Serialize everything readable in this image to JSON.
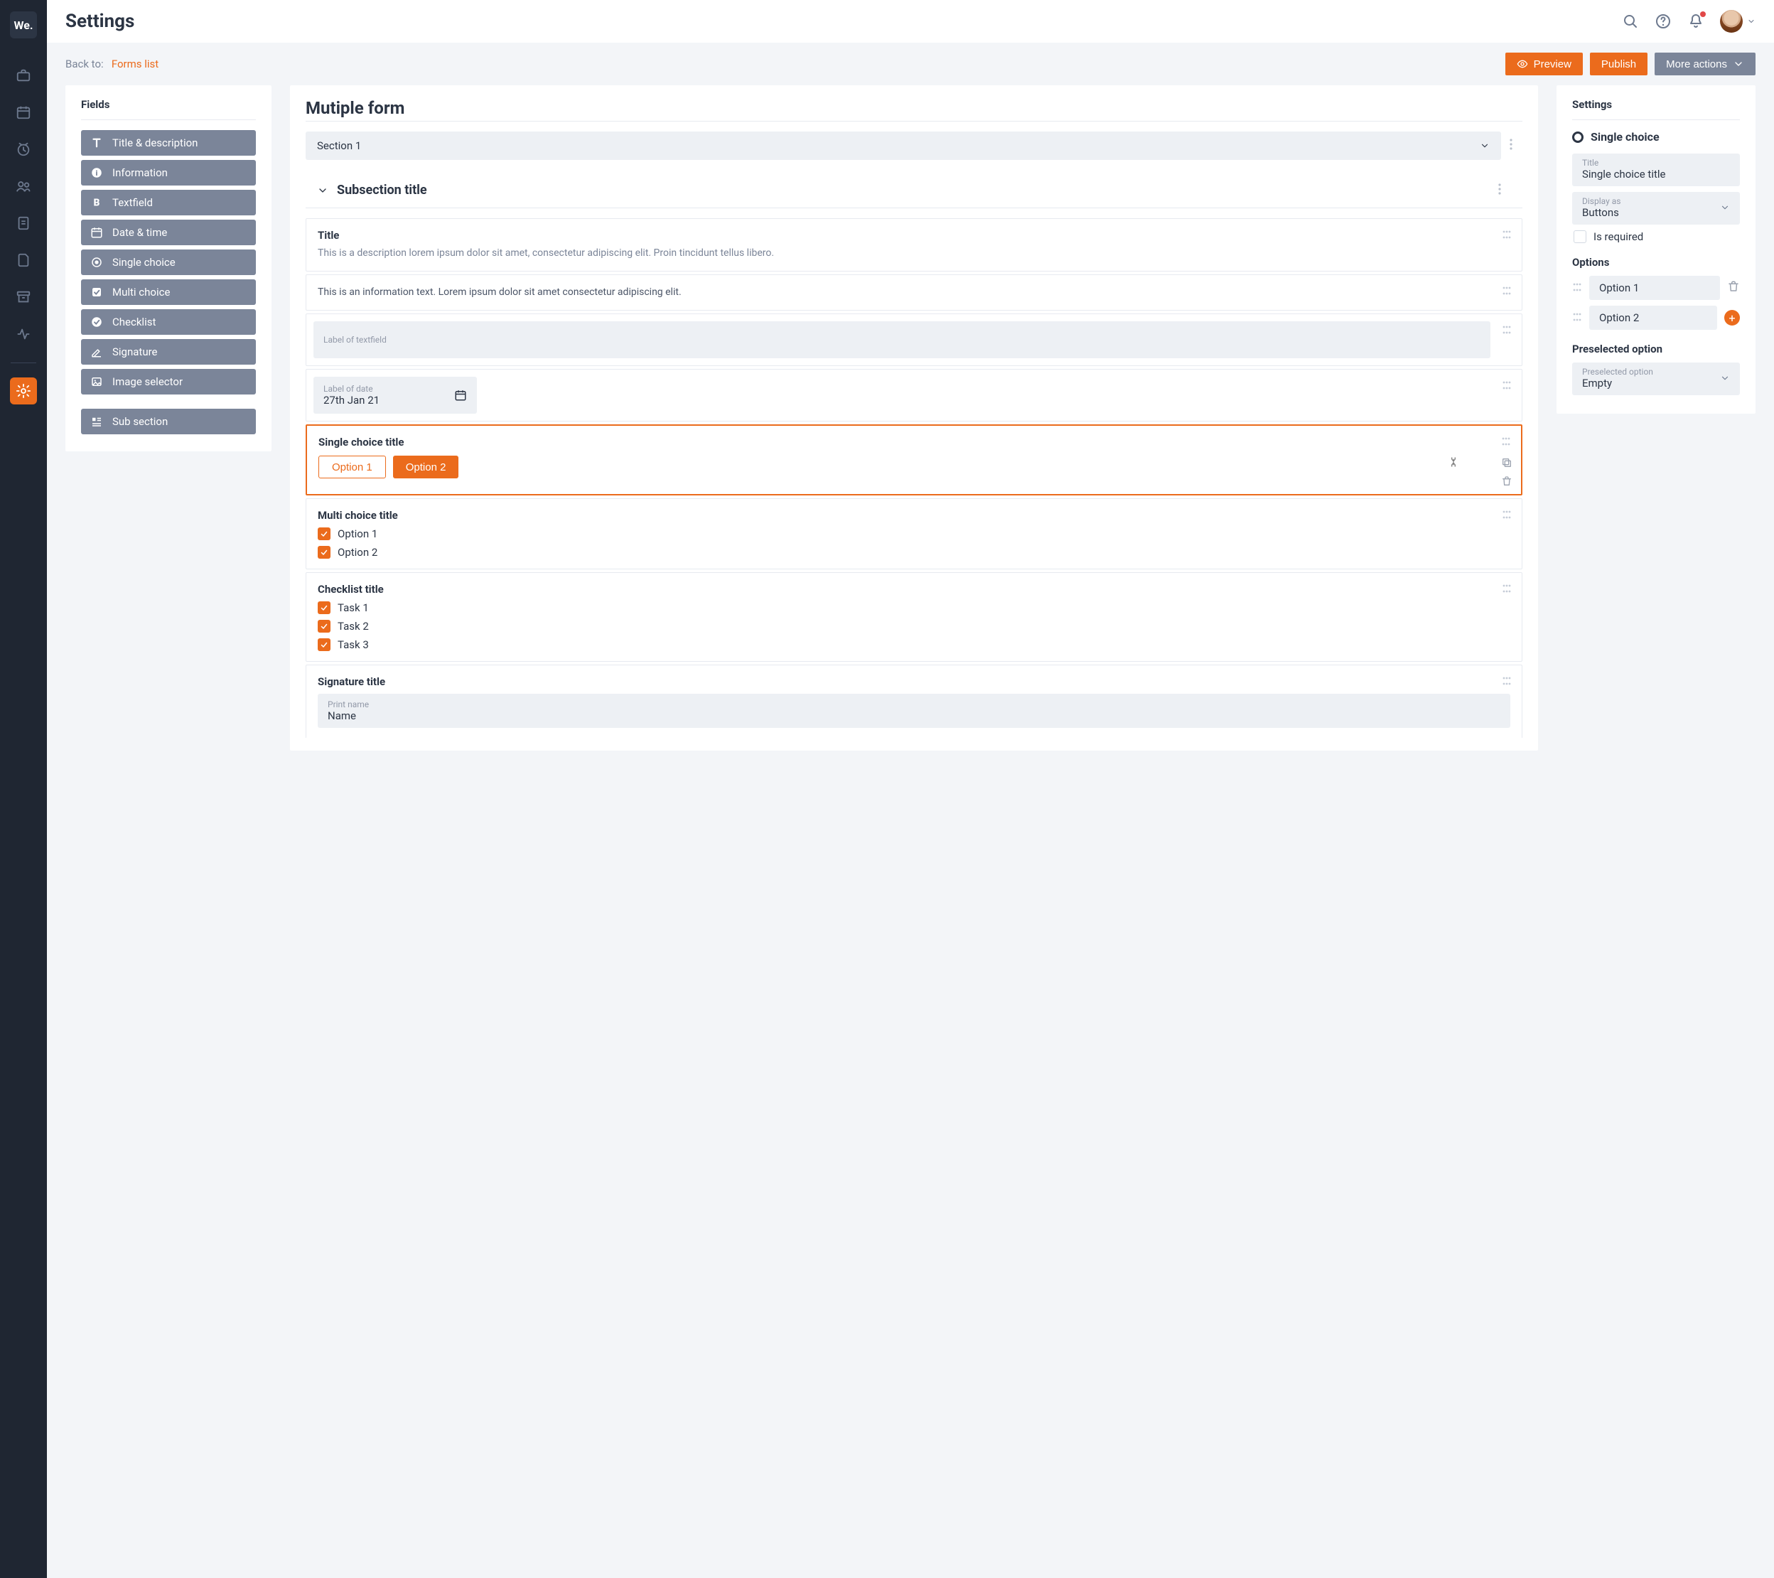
{
  "logo_text": "We.",
  "page_title": "Settings",
  "back": {
    "label": "Back to:",
    "link": "Forms list"
  },
  "actions": {
    "preview": "Preview",
    "publish": "Publish",
    "more": "More actions"
  },
  "fields_panel": {
    "title": "Fields",
    "items": [
      "Title & description",
      "Information",
      "Textfield",
      "Date & time",
      "Single choice",
      "Multi choice",
      "Checklist",
      "Signature",
      "Image selector"
    ],
    "subsection": "Sub section"
  },
  "builder": {
    "title": "Mutiple form",
    "section": "Section 1",
    "subsection": "Subsection title",
    "title_block": {
      "title": "Title",
      "desc": "This is a description lorem ipsum dolor sit amet, consectetur adipiscing elit. Proin tincidunt tellus libero."
    },
    "info_text": "This is an information text. Lorem ipsum dolor sit amet consectetur adipiscing elit.",
    "textfield_label": "Label of textfield",
    "date": {
      "label": "Label of date",
      "value": "27th Jan 21"
    },
    "single": {
      "title": "Single choice title",
      "opt1": "Option 1",
      "opt2": "Option 2"
    },
    "multi": {
      "title": "Multi choice title",
      "opt1": "Option 1",
      "opt2": "Option 2"
    },
    "checklist": {
      "title": "Checklist title",
      "t1": "Task 1",
      "t2": "Task 2",
      "t3": "Task 3"
    },
    "signature": {
      "title": "Signature title",
      "print_label": "Print name",
      "print_value": "Name"
    }
  },
  "settings_panel": {
    "title": "Settings",
    "component": "Single choice",
    "title_label": "Title",
    "title_value": "Single choice title",
    "display_label": "Display as",
    "display_value": "Buttons",
    "required": "Is required",
    "options_title": "Options",
    "opt1": "Option 1",
    "opt2": "Option 2",
    "presel_title": "Preselected option",
    "presel_label": "Preselected option",
    "presel_value": "Empty"
  }
}
